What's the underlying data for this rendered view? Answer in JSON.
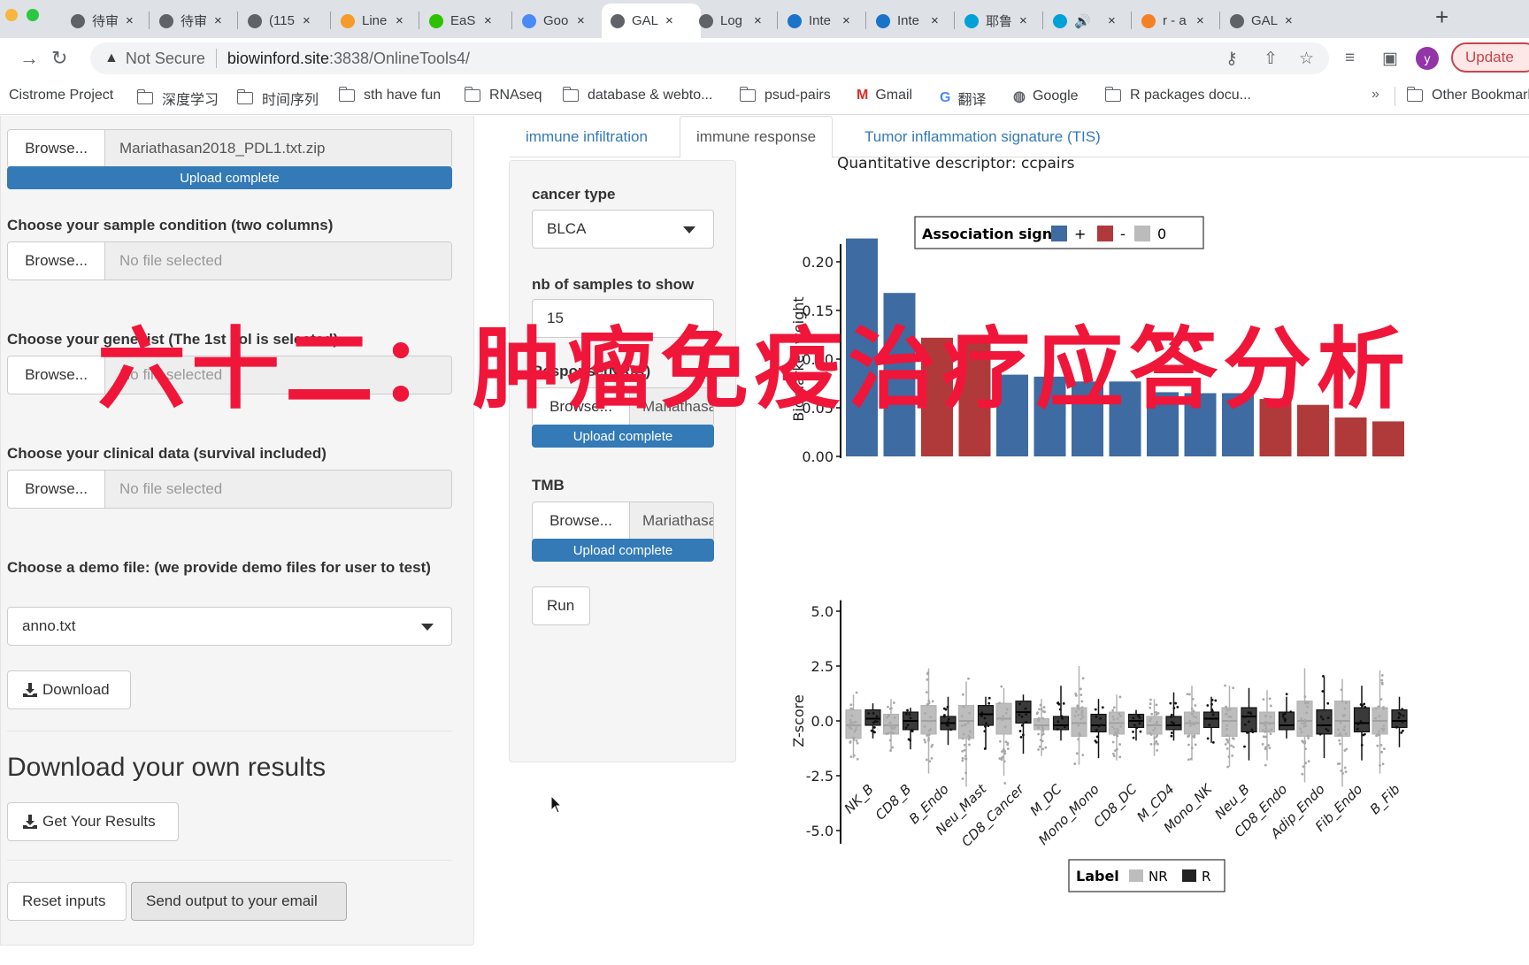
{
  "browser": {
    "tabs": [
      {
        "label": "待审",
        "icon": "globe-icon",
        "active": false
      },
      {
        "label": "待审",
        "icon": "globe-icon",
        "active": false
      },
      {
        "label": "(115",
        "icon": "globe-icon",
        "active": false
      },
      {
        "label": "Line",
        "icon": "chart-app-icon",
        "active": false
      },
      {
        "label": "EaS",
        "icon": "wechat-icon",
        "active": false
      },
      {
        "label": "Goo",
        "icon": "google-translate-icon",
        "active": false
      },
      {
        "label": "GAL",
        "icon": "globe-icon",
        "active": true
      },
      {
        "label": "Log",
        "icon": "globe-icon",
        "active": false
      },
      {
        "label": "Inte",
        "icon": "link-app-icon",
        "active": false
      },
      {
        "label": "Inte",
        "icon": "link-app-icon",
        "active": false
      },
      {
        "label": "耶鲁",
        "icon": "bilibili-icon",
        "active": false
      },
      {
        "label": "🔊",
        "icon": "bilibili-icon",
        "active": false
      },
      {
        "label": "r - a",
        "icon": "stackoverflow-icon",
        "active": false
      },
      {
        "label": "GAL",
        "icon": "globe-icon",
        "active": false
      }
    ],
    "address": {
      "security_label": "Not Secure",
      "url_host": "biowinford.site",
      "url_rest": ":3838/OnlineTools4/"
    },
    "avatar_letter": "y",
    "update_label": "Update",
    "bookmarks": [
      {
        "label": "Cistrome Project",
        "icon": "none"
      },
      {
        "label": "深度学习",
        "icon": "folder-icon"
      },
      {
        "label": "时间序列",
        "icon": "folder-icon"
      },
      {
        "label": "sth have fun",
        "icon": "folder-icon"
      },
      {
        "label": "RNAseq",
        "icon": "folder-icon"
      },
      {
        "label": "database & webto...",
        "icon": "folder-icon"
      },
      {
        "label": "psud-pairs",
        "icon": "folder-icon"
      },
      {
        "label": "Gmail",
        "icon": "gmail-icon"
      },
      {
        "label": "翻译",
        "icon": "google-translate-icon"
      },
      {
        "label": "Google",
        "icon": "globe-icon"
      },
      {
        "label": "R packages docu...",
        "icon": "folder-icon"
      }
    ],
    "bookmarks_overflow": "»",
    "other_bookmarks": "Other Bookmarks"
  },
  "sidebar": {
    "expr_file": {
      "browse": "Browse...",
      "filename": "Mariathasan2018_PDL1.txt.zip",
      "progress": "Upload complete"
    },
    "sample_condition": {
      "label": "Choose your sample condition (two columns)",
      "browse": "Browse...",
      "filename": "No file selected"
    },
    "gene_list": {
      "label": "Choose your gene list (The 1st col is selected)",
      "browse": "Browse...",
      "filename": "No file selected"
    },
    "clinical": {
      "label": "Choose your clinical data (survival included)",
      "browse": "Browse...",
      "filename": "No file selected"
    },
    "demo": {
      "label": "Choose a demo file: (we provide demo files for user to test)",
      "selected": "anno.txt",
      "download_label": "Download"
    },
    "own_results": {
      "heading": "Download your own results",
      "button": "Get Your Results"
    },
    "reset_label": "Reset inputs",
    "email_label": "Send output to your email"
  },
  "main": {
    "tabs": [
      {
        "label": "immune infiltration",
        "active": false
      },
      {
        "label": "immune response",
        "active": true
      },
      {
        "label": "Tumor inflammation signature (TIS)",
        "active": false
      }
    ],
    "panel": {
      "cancer_type_label": "cancer type",
      "cancer_type_value": "BLCA",
      "nb_samples_label": "nb of samples to show",
      "nb_samples_value": "15",
      "response_label": "Response(NR/R)",
      "response_browse": "Browse...",
      "response_file": "Mariathasan",
      "response_progress": "Upload complete",
      "tmb_label": "TMB",
      "tmb_browse": "Browse...",
      "tmb_file": "Mariathasan",
      "tmb_progress": "Upload complete",
      "run_label": "Run"
    }
  },
  "overlay_title": "六十二：肿瘤免疫治疗应答分析",
  "colors": {
    "positive": "#3e6ba1",
    "negative": "#b03a3a",
    "zero": "#bbbbbb",
    "nr": "#b3b3b3",
    "r": "#222222",
    "accent": "#337ab7",
    "overlay": "#f0163a"
  },
  "chart_data": [
    {
      "type": "bar",
      "title": "Quantitative descriptor: ccpairs",
      "xlabel": "",
      "ylabel": "Biomarker weight",
      "ylim": [
        0,
        0.23
      ],
      "yticks": [
        "0.00",
        "0.05",
        "0.10",
        "0.15",
        "0.20"
      ],
      "categories": [
        "NK_B",
        "CD8_B",
        "B_Endo",
        "Neu_Mast",
        "CD8_Cancer",
        "M_DC",
        "Mono_Mono",
        "CD8_DC",
        "M_CD4",
        "Mono_NK",
        "Neu_B",
        "CD8_Endo",
        "Adip_Endo",
        "Fib_Endo",
        "B_Fib"
      ],
      "values": [
        0.224,
        0.168,
        0.122,
        0.118,
        0.084,
        0.082,
        0.077,
        0.077,
        0.066,
        0.065,
        0.065,
        0.059,
        0.053,
        0.04,
        0.036
      ],
      "signs": [
        "+",
        "+",
        "-",
        "-",
        "+",
        "+",
        "+",
        "+",
        "+",
        "+",
        "+",
        "-",
        "-",
        "-",
        "-"
      ],
      "legend": {
        "title": "Association sign",
        "entries": [
          "+",
          "-",
          "0"
        ],
        "position": "top"
      }
    },
    {
      "type": "box",
      "ylabel": "Z-score",
      "ylim": [
        -5.5,
        5.5
      ],
      "yticks": [
        "5.0",
        "2.5",
        "0.0",
        "-2.5",
        "-5.0"
      ],
      "categories": [
        "NK_B",
        "CD8_B",
        "B_Endo",
        "Neu_Mast",
        "CD8_Cancer",
        "M_DC",
        "Mono_Mono",
        "CD8_DC",
        "M_CD4",
        "Mono_NK",
        "Neu_B",
        "CD8_Endo",
        "Adip_Endo",
        "Fib_Endo",
        "B_Fib"
      ],
      "legend": {
        "title": "Label",
        "entries": [
          "NR",
          "R"
        ],
        "position": "bottom"
      },
      "series": [
        {
          "name": "NR",
          "q1": [
            -0.8,
            -0.6,
            -0.6,
            -0.8,
            -0.6,
            -0.4,
            -0.7,
            -0.6,
            -0.6,
            -0.6,
            -0.7,
            -0.5,
            -0.7,
            -0.7,
            -0.6
          ],
          "median": [
            -0.2,
            -0.2,
            0.0,
            0.0,
            0.1,
            -0.2,
            -0.1,
            -0.1,
            -0.2,
            -0.1,
            0.0,
            -0.1,
            0.0,
            0.0,
            0.0
          ],
          "q3": [
            0.5,
            0.3,
            0.7,
            0.7,
            0.8,
            0.1,
            0.6,
            0.4,
            0.2,
            0.4,
            0.6,
            0.4,
            0.9,
            0.9,
            0.6
          ],
          "whisker_low": [
            -1.7,
            -1.4,
            -2.4,
            -3.0,
            -2.5,
            -1.6,
            -2.0,
            -1.8,
            -1.6,
            -1.8,
            -2.1,
            -1.8,
            -2.8,
            -3.0,
            -2.4
          ],
          "whisker_high": [
            1.2,
            1.0,
            2.4,
            1.8,
            1.5,
            1.0,
            2.5,
            1.2,
            1.0,
            1.6,
            1.6,
            1.4,
            2.4,
            1.9,
            2.3
          ]
        },
        {
          "name": "R",
          "q1": [
            -0.2,
            -0.4,
            -0.4,
            -0.2,
            -0.1,
            -0.4,
            -0.5,
            -0.3,
            -0.4,
            -0.3,
            -0.5,
            -0.4,
            -0.6,
            -0.5,
            -0.3
          ],
          "median": [
            0.1,
            0.0,
            -0.1,
            0.3,
            0.4,
            -0.2,
            -0.2,
            0.0,
            -0.2,
            0.1,
            0.2,
            -0.2,
            -0.2,
            -0.1,
            0.0
          ],
          "q3": [
            0.5,
            0.4,
            0.2,
            0.7,
            0.9,
            0.2,
            0.3,
            0.3,
            0.2,
            0.4,
            0.6,
            0.4,
            0.5,
            0.6,
            0.5
          ],
          "whisker_low": [
            -0.8,
            -1.3,
            -1.1,
            -1.3,
            -1.5,
            -0.9,
            -1.7,
            -0.9,
            -0.9,
            -1.0,
            -1.8,
            -0.8,
            -1.7,
            -1.8,
            -1.2
          ],
          "whisker_high": [
            0.8,
            0.6,
            1.1,
            1.1,
            1.2,
            1.6,
            1.0,
            0.5,
            1.3,
            1.1,
            1.5,
            1.1,
            2.0,
            1.6,
            1.1
          ]
        }
      ]
    }
  ]
}
